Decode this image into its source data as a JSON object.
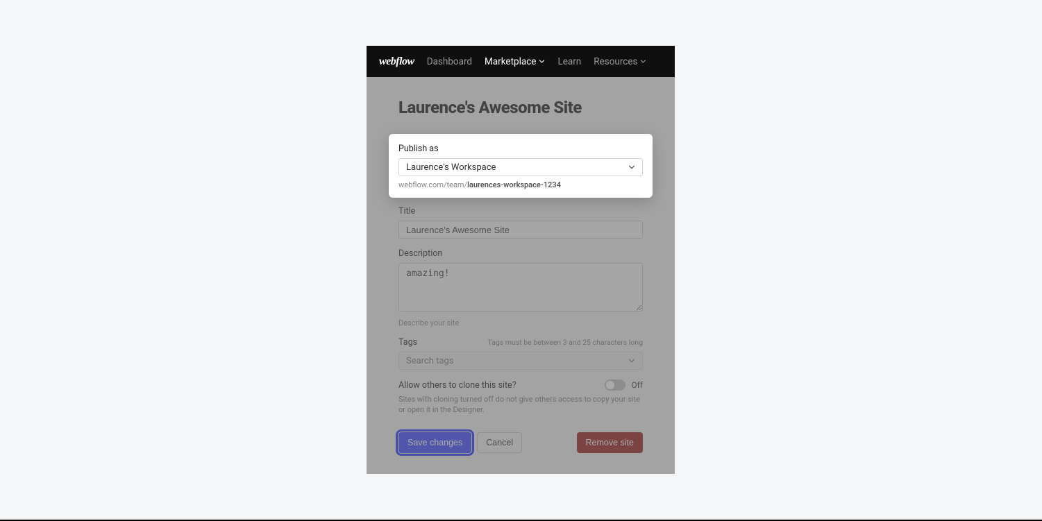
{
  "brand": "webflow",
  "nav": {
    "dashboard": "Dashboard",
    "marketplace": "Marketplace",
    "learn": "Learn",
    "resources": "Resources"
  },
  "page": {
    "title": "Laurence's Awesome Site"
  },
  "publish": {
    "label": "Publish as",
    "selected": "Laurence's Workspace",
    "url_prefix": "webflow.com/team/",
    "url_slug": "laurences-workspace-1234"
  },
  "title_field": {
    "label": "Title",
    "value": "Laurence's Awesome Site"
  },
  "description_field": {
    "label": "Description",
    "value": "amazing!",
    "helper": "Describe your site"
  },
  "tags_field": {
    "label": "Tags",
    "hint": "Tags must be between 3 and 25 characters long",
    "placeholder": "Search tags"
  },
  "clone": {
    "label": "Allow others to clone this site?",
    "state": "Off",
    "helper": "Sites with cloning turned off do not give others access to copy your site or open it in the Designer."
  },
  "actions": {
    "save": "Save changes",
    "cancel": "Cancel",
    "remove": "Remove site"
  }
}
